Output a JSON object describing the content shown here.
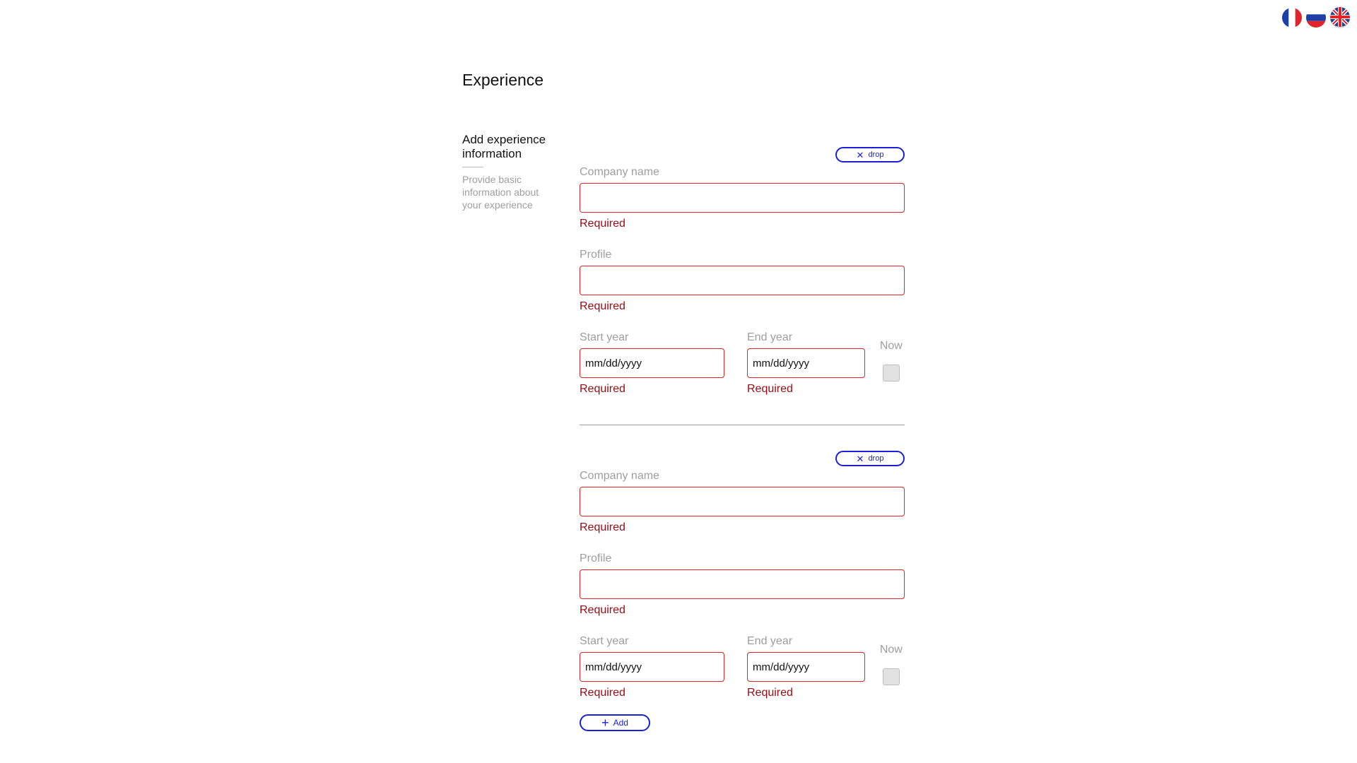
{
  "languages": [
    {
      "code": "fr",
      "icon": "france-flag-icon"
    },
    {
      "code": "ru",
      "icon": "russia-flag-icon"
    },
    {
      "code": "en",
      "icon": "uk-flag-icon",
      "active": true
    }
  ],
  "page": {
    "title": "Experience"
  },
  "sidebar": {
    "title": "Add experience information",
    "description": "Provide basic information about your experience"
  },
  "entries": [
    {
      "drop_label": "drop",
      "company_label": "Company name",
      "company_value": "",
      "company_error": "Required",
      "profile_label": "Profile",
      "profile_value": "",
      "profile_error": "Required",
      "start_label": "Start year",
      "start_placeholder": "mm/dd/yyyy",
      "start_error": "Required",
      "end_label": "End year",
      "end_placeholder": "mm/dd/yyyy",
      "end_error": "Required",
      "now_label": "Now",
      "now_checked": false
    },
    {
      "drop_label": "drop",
      "company_label": "Company name",
      "company_value": "",
      "company_error": "Required",
      "profile_label": "Profile",
      "profile_value": "",
      "profile_error": "Required",
      "start_label": "Start year",
      "start_placeholder": "mm/dd/yyyy",
      "start_error": "Required",
      "end_label": "End year",
      "end_placeholder": "mm/dd/yyyy",
      "end_error": "Required",
      "now_label": "Now",
      "now_checked": false
    }
  ],
  "add_button": {
    "label": "Add"
  },
  "colors": {
    "accent_blue": "#1a20d6",
    "error_border": "#e0242a",
    "error_text": "#9b0a12",
    "muted_text": "#9e9e9e"
  }
}
